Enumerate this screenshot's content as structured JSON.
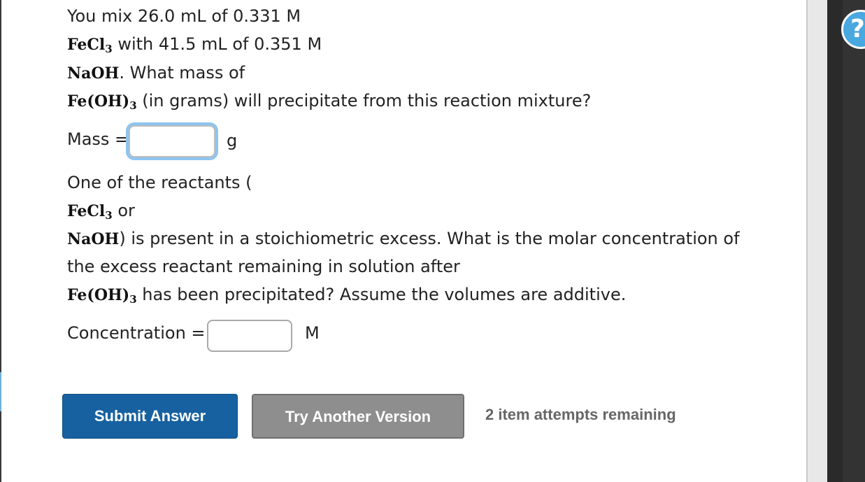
{
  "q1": {
    "line1": "You mix 26.0 mL of 0.331 M",
    "chem_fecl3": "FeCl",
    "chem_fecl3_sub": "3",
    "line2_rest": " with 41.5 mL of 0.351 M",
    "chem_naoh": "NaOH",
    "line3_rest": ". What mass of",
    "chem_feoh3": "Fe(OH)",
    "chem_feoh3_sub": "3",
    "line4_rest": " (in grams) will precipitate from this reaction mixture?",
    "mass_label": "Mass =",
    "mass_value": "",
    "mass_unit": "g"
  },
  "q2": {
    "line1": "One of the reactants (",
    "chem_fecl3": "FeCl",
    "chem_fecl3_sub": "3",
    "line2_rest": " or",
    "chem_naoh": "NaOH",
    "line3_rest": ") is present in a stoichiometric excess. What is the molar concentration of",
    "line4": "the excess reactant remaining in solution after",
    "chem_feoh3": "Fe(OH)",
    "chem_feoh3_sub": "3",
    "line5_rest": " has been precipitated? Assume the volumes are additive.",
    "conc_label": "Concentration =",
    "conc_value": "",
    "conc_unit": "M"
  },
  "actions": {
    "submit": "Submit Answer",
    "try_another": "Try Another Version",
    "attempts": "2 item attempts remaining"
  },
  "help_icon": "?",
  "colors": {
    "primary": "#1761a0",
    "secondary": "#8e8e8e",
    "focus_ring": "#8ec5f0",
    "help": "#48a8df"
  }
}
